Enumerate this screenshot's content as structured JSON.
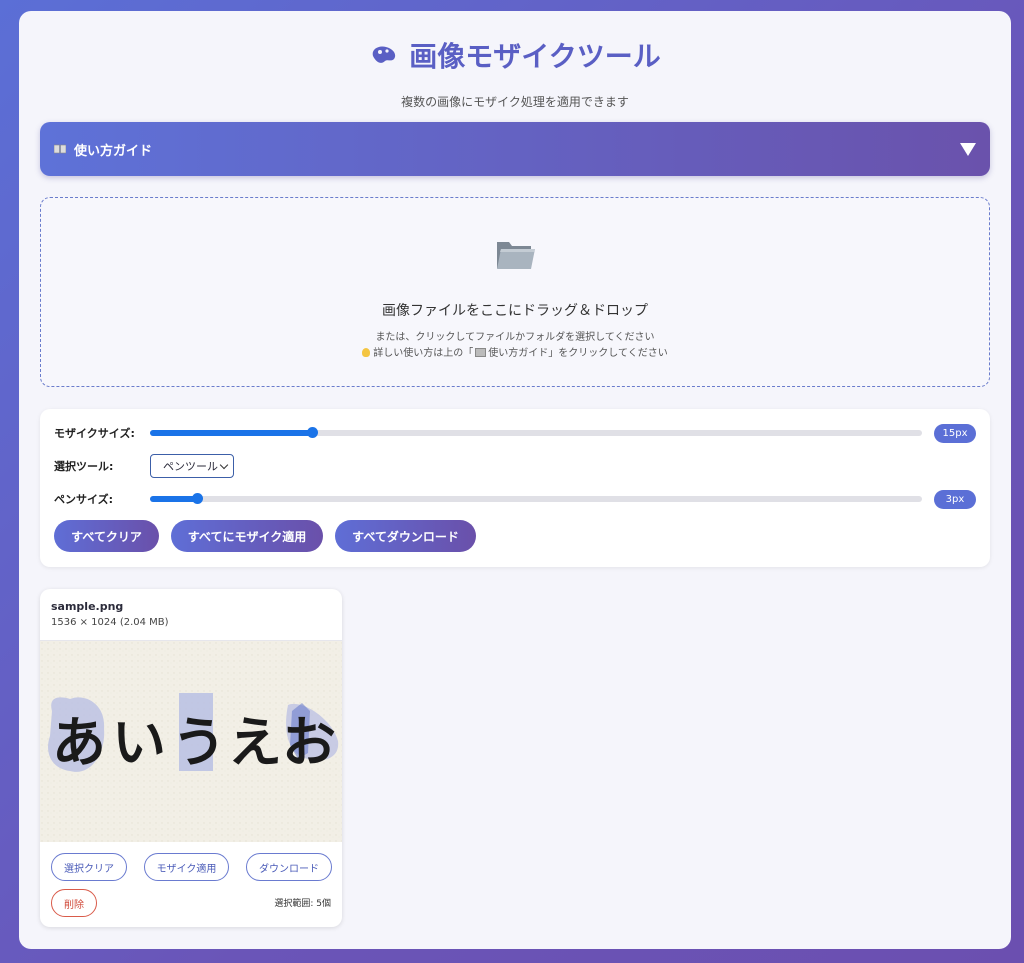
{
  "app": {
    "title": "画像モザイクツール",
    "subtitle": "複数の画像にモザイク処理を適用できます"
  },
  "guide": {
    "label": "使い方ガイド",
    "icon": "book-icon",
    "state": "collapsed"
  },
  "dropzone": {
    "main_text": "画像ファイルをここにドラッグ＆ドロップ",
    "sub_text": "または、クリックしてファイルかフォルダを選択してください",
    "hint_prefix": "詳しい使い方は上の「",
    "hint_link": "使い方ガイド",
    "hint_suffix": "」をクリックしてください"
  },
  "controls": {
    "mosaic_size": {
      "label": "モザイクサイズ:",
      "value_text": "15px",
      "fraction": 0.21
    },
    "tool": {
      "label": "選択ツール:",
      "selected": "ペンツール"
    },
    "pen_size": {
      "label": "ペンサイズ:",
      "value_text": "3px",
      "fraction": 0.061
    },
    "buttons": {
      "clear_all": "すべてクリア",
      "apply_all": "すべてにモザイク適用",
      "download_all": "すべてダウンロード"
    }
  },
  "images": [
    {
      "file_name": "sample.png",
      "info": "1536 × 1024 (2.04 MB)",
      "preview_text": [
        "あ",
        "い",
        "う",
        "え",
        "お"
      ],
      "buttons": {
        "clear_selection": "選択クリア",
        "apply_mosaic": "モザイク適用",
        "download": "ダウンロード",
        "delete": "削除"
      },
      "selection_count": "選択範囲: 5個"
    }
  ],
  "colors": {
    "accent": "#5a5fc4",
    "slider": "#1a73e8",
    "delete": "#d04a3a"
  }
}
